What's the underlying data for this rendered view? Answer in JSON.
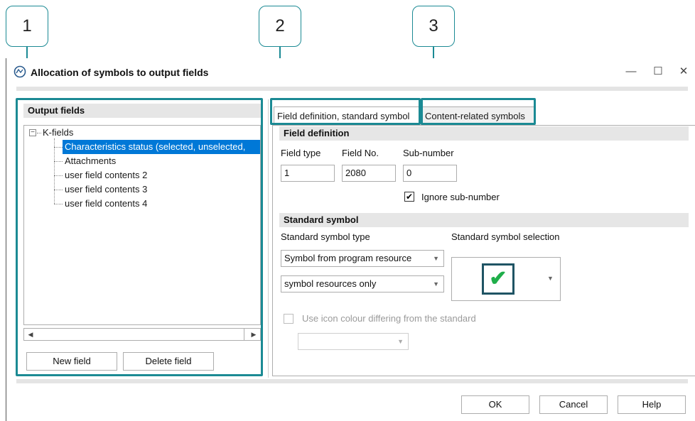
{
  "callouts": [
    "1",
    "2",
    "3"
  ],
  "window": {
    "title": "Allocation of symbols to output fields",
    "controls": {
      "minimize": "—",
      "maximize": "☐",
      "close": "✕"
    }
  },
  "left": {
    "header": "Output fields",
    "tree": {
      "root": "K-fields",
      "expander": "−",
      "children": [
        "Characteristics status (selected, unselected,",
        "Attachments",
        "user field contents 2",
        "user field contents 3",
        "user field contents 4"
      ]
    },
    "new_field": "New field",
    "delete_field": "Delete field",
    "scroll_left": "◀",
    "scroll_right": "▶"
  },
  "tabs": [
    "Field definition, standard symbol",
    "Content-related symbols"
  ],
  "field_definition": {
    "header": "Field definition",
    "field_type_label": "Field type",
    "field_no_label": "Field No.",
    "sub_number_label": "Sub-number",
    "field_type": "1",
    "field_no": "2080",
    "sub_number": "0",
    "ignore_label": "Ignore sub-number",
    "ignore_mark": "✔"
  },
  "standard_symbol": {
    "header": "Standard symbol",
    "type_label": "Standard symbol type",
    "selection_label": "Standard symbol selection",
    "type_value": "Symbol from program resource",
    "resource_value": "symbol resources only",
    "symbol_glyph": "✔",
    "dropdown_arrow": "▼",
    "icon_colour_label": "Use icon colour differing from the standard"
  },
  "buttons": {
    "ok": "OK",
    "cancel": "Cancel",
    "help": "Help"
  },
  "colors": {
    "highlight": "#1b8a94",
    "selection": "#0078d7",
    "check": "#1fae4a"
  }
}
